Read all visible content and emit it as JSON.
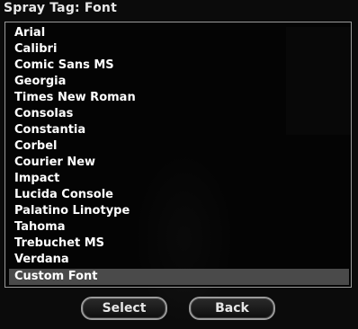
{
  "dialog": {
    "title": "Spray Tag: Font"
  },
  "font_list": {
    "items": [
      {
        "label": "Arial"
      },
      {
        "label": "Calibri"
      },
      {
        "label": "Comic Sans MS"
      },
      {
        "label": "Georgia"
      },
      {
        "label": "Times New Roman"
      },
      {
        "label": "Consolas"
      },
      {
        "label": "Constantia"
      },
      {
        "label": "Corbel"
      },
      {
        "label": "Courier New"
      },
      {
        "label": "Impact"
      },
      {
        "label": "Lucida Console"
      },
      {
        "label": "Palatino Linotype"
      },
      {
        "label": "Tahoma"
      },
      {
        "label": "Trebuchet MS"
      },
      {
        "label": "Verdana"
      },
      {
        "label": "Custom Font"
      }
    ],
    "selected_label": "Custom Font"
  },
  "buttons": {
    "select_label": "Select",
    "back_label": "Back"
  }
}
